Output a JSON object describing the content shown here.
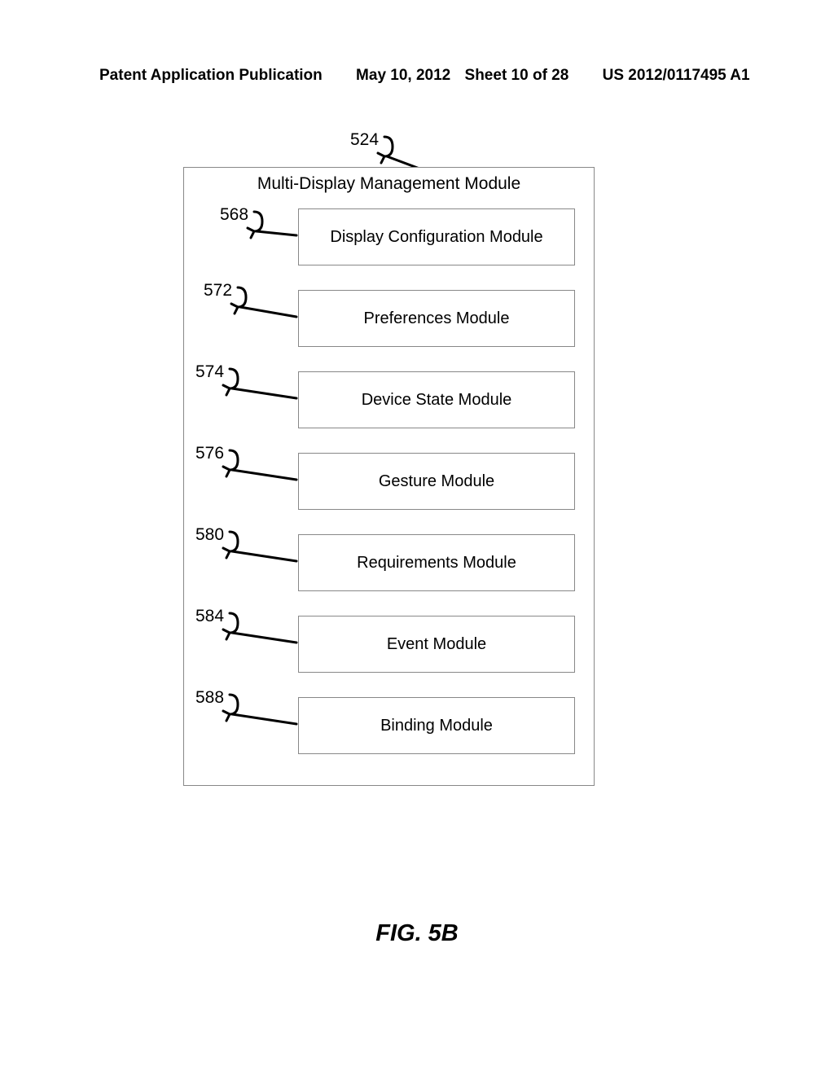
{
  "header": {
    "pub_label": "Patent Application Publication",
    "date": "May 10, 2012",
    "sheet": "Sheet 10 of 28",
    "pubno": "US 2012/0117495 A1"
  },
  "figure_label": "FIG. 5B",
  "outer": {
    "ref": "524",
    "title": "Multi-Display Management Module"
  },
  "modules": [
    {
      "ref": "568",
      "label": "Display Configuration Module"
    },
    {
      "ref": "572",
      "label": "Preferences Module"
    },
    {
      "ref": "574",
      "label": "Device State Module"
    },
    {
      "ref": "576",
      "label": "Gesture Module"
    },
    {
      "ref": "580",
      "label": "Requirements Module"
    },
    {
      "ref": "584",
      "label": "Event Module"
    },
    {
      "ref": "588",
      "label": "Binding Module"
    }
  ]
}
